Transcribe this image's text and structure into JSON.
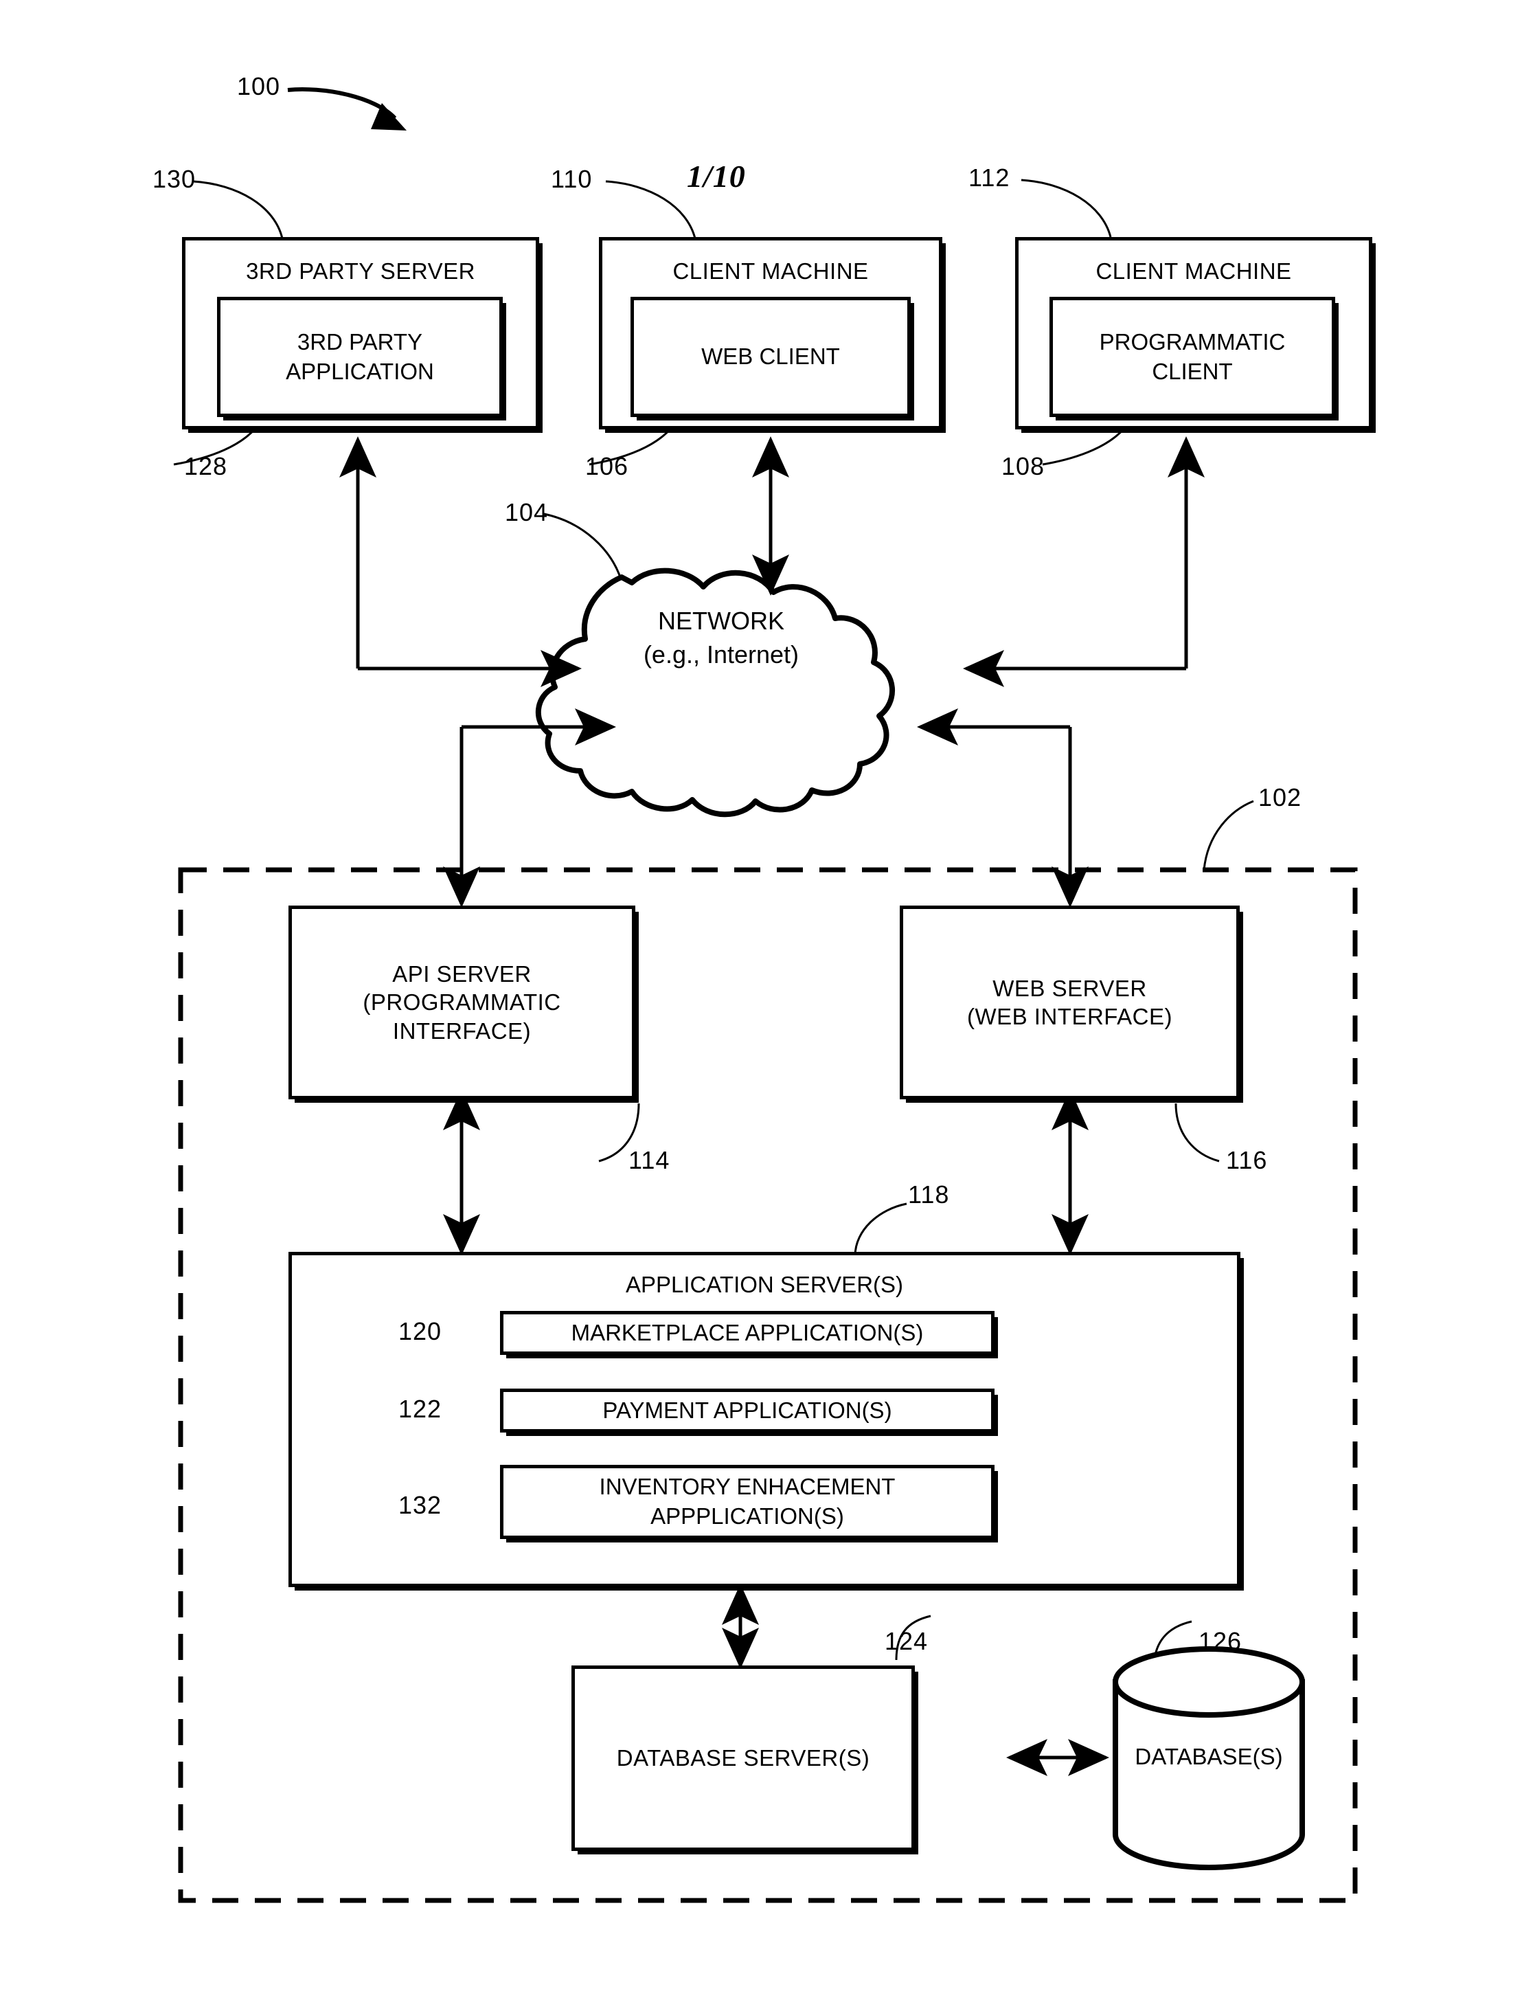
{
  "figure": {
    "page_number": "1/10",
    "system_ref": "100",
    "networked_system_ref": "102"
  },
  "refs": {
    "system": "100",
    "networked_system": "102",
    "network": "104",
    "web_client": "106",
    "programmatic_client": "108",
    "client_machine_web": "110",
    "client_machine_prog": "112",
    "api_server": "114",
    "web_server": "116",
    "application_server": "118",
    "marketplace_app": "120",
    "payment_app": "122",
    "database_server": "124",
    "database": "126",
    "third_party_application": "128",
    "third_party_server": "130",
    "inventory_enhancement_app": "132"
  },
  "nodes": {
    "third_party_server": {
      "title": "3RD PARTY SERVER",
      "inner": "3RD PARTY\nAPPLICATION"
    },
    "client_machine_web": {
      "title": "CLIENT MACHINE",
      "inner": "WEB CLIENT"
    },
    "client_machine_prog": {
      "title": "CLIENT MACHINE",
      "inner": "PROGRAMMATIC\nCLIENT"
    },
    "network": {
      "label": "NETWORK\n(e.g., Internet)"
    },
    "api_server": {
      "title": "API SERVER\n(PROGRAMMATIC\nINTERFACE)"
    },
    "web_server": {
      "title": "WEB SERVER\n(WEB INTERFACE)"
    },
    "application_server": {
      "title": "APPLICATION SERVER(S)",
      "applications": [
        {
          "label": "MARKETPLACE APPLICATION(S)",
          "ref": "120"
        },
        {
          "label": "PAYMENT APPLICATION(S)",
          "ref": "122"
        },
        {
          "label": "INVENTORY ENHACEMENT\nAPPPLICATION(S)",
          "ref": "132"
        }
      ]
    },
    "database_server": {
      "title": "DATABASE SERVER(S)"
    },
    "database": {
      "title": "DATABASE(S)"
    }
  },
  "colors": {
    "stroke": "#000000",
    "background": "#ffffff"
  }
}
